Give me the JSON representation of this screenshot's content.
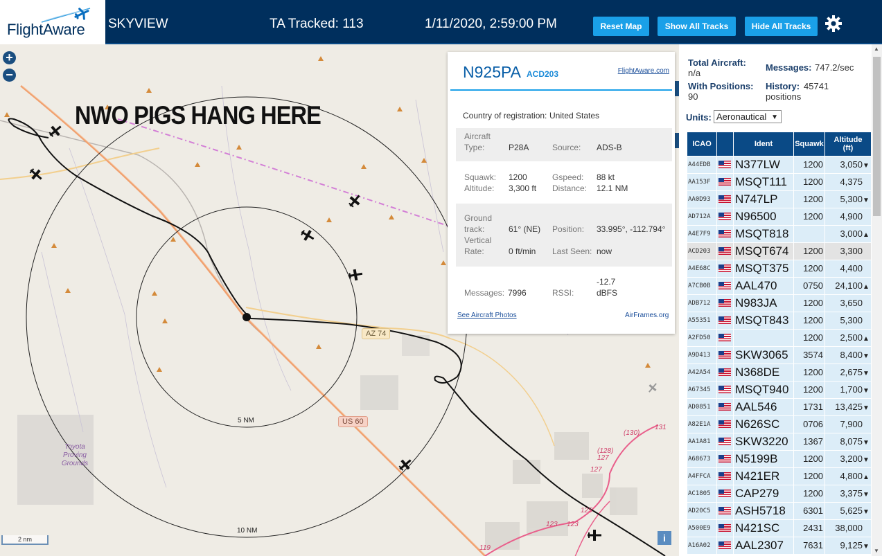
{
  "header": {
    "logo_text": "FlightAware",
    "app_name": "SKYVIEW",
    "ta_tracked": "TA Tracked: 113",
    "datetime": "1/11/2020, 2:59:00 PM",
    "reset_map": "Reset Map",
    "show_all_tracks": "Show All Tracks",
    "hide_all_tracks": "Hide All Tracks"
  },
  "map": {
    "zoom_in": "+",
    "zoom_out": "−",
    "annotation": "NWO PIGS HANG HERE",
    "ring_5": "5 NM",
    "ring_10": "10 NM",
    "road_az74": "AZ 74",
    "road_us60": "US 60",
    "place_label": "Toyota Proving Grounds",
    "scale": "2 nm",
    "info": "i",
    "road_nums": [
      "131",
      "(130)",
      "(128)",
      "127",
      "127",
      "125",
      "123",
      "123",
      "119"
    ]
  },
  "popup": {
    "registration": "N925PA",
    "ident": "ACD203",
    "fa_link": "FlightAware.com",
    "country_label": "Country of registration:",
    "country": "United States",
    "aircraft_type_label": "Aircraft Type:",
    "aircraft_type": "P28A",
    "source_label": "Source:",
    "source": "ADS-B",
    "squawk_label": "Squawk:",
    "squawk": "1200",
    "gspeed_label": "Gspeed:",
    "gspeed": "88 kt",
    "altitude_label": "Altitude:",
    "altitude": "3,300 ft",
    "distance_label": "Distance:",
    "distance": "12.1 NM",
    "ground_track_label": "Ground track:",
    "ground_track": "61° (NE)",
    "position_label": "Position:",
    "position": "33.995°, -112.794°",
    "vertical_rate_label": "Vertical Rate:",
    "vertical_rate": "0 ft/min",
    "last_seen_label": "Last Seen:",
    "last_seen": "now",
    "messages_label": "Messages:",
    "messages": "7996",
    "rssi_label": "RSSI:",
    "rssi": "-12.7 dBFS",
    "photos_link": "See Aircraft Photos",
    "airframes_link": "AirFrames.org"
  },
  "side": {
    "total_aircraft_label": "Total Aircraft:",
    "total_aircraft": "n/a",
    "messages_label": "Messages:",
    "messages": "747.2/sec",
    "with_positions_label": "With Positions:",
    "with_positions": "90",
    "history_label": "History:",
    "history": "45741 positions",
    "units_label": "Units:",
    "units_value": "Aeronautical",
    "columns": [
      "ICAO",
      "Ident",
      "Squawk",
      "Altitude (ft)"
    ],
    "rows": [
      {
        "icao": "A44EDB",
        "ident": "N377LW",
        "squawk": "1200",
        "alt": "3,050",
        "trend": "▼"
      },
      {
        "icao": "AA153F",
        "ident": "MSQT111",
        "squawk": "1200",
        "alt": "4,375",
        "trend": ""
      },
      {
        "icao": "AA0D93",
        "ident": "N747LP",
        "squawk": "1200",
        "alt": "5,300",
        "trend": "▼"
      },
      {
        "icao": "AD712A",
        "ident": "N96500",
        "squawk": "1200",
        "alt": "4,900",
        "trend": ""
      },
      {
        "icao": "A4E7F9",
        "ident": "MSQT818",
        "squawk": "",
        "alt": "3,000",
        "trend": "▲"
      },
      {
        "icao": "ACD203",
        "ident": "MSQT674",
        "squawk": "1200",
        "alt": "3,300",
        "trend": ""
      },
      {
        "icao": "A4E68C",
        "ident": "MSQT375",
        "squawk": "1200",
        "alt": "4,400",
        "trend": ""
      },
      {
        "icao": "A7CB0B",
        "ident": "AAL470",
        "squawk": "0750",
        "alt": "24,100",
        "trend": "▲"
      },
      {
        "icao": "ADB712",
        "ident": "N983JA",
        "squawk": "1200",
        "alt": "3,650",
        "trend": ""
      },
      {
        "icao": "A55351",
        "ident": "MSQT843",
        "squawk": "1200",
        "alt": "5,300",
        "trend": ""
      },
      {
        "icao": "A2FD50",
        "ident": "",
        "squawk": "1200",
        "alt": "2,500",
        "trend": "▲"
      },
      {
        "icao": "A9D413",
        "ident": "SKW3065",
        "squawk": "3574",
        "alt": "8,400",
        "trend": "▼"
      },
      {
        "icao": "A42A54",
        "ident": "N368DE",
        "squawk": "1200",
        "alt": "2,675",
        "trend": "▼"
      },
      {
        "icao": "A67345",
        "ident": "MSQT940",
        "squawk": "1200",
        "alt": "1,700",
        "trend": "▼"
      },
      {
        "icao": "AD0851",
        "ident": "AAL546",
        "squawk": "1731",
        "alt": "13,425",
        "trend": "▼"
      },
      {
        "icao": "A82E1A",
        "ident": "N626SC",
        "squawk": "0706",
        "alt": "7,900",
        "trend": ""
      },
      {
        "icao": "AA1A81",
        "ident": "SKW3220",
        "squawk": "1367",
        "alt": "8,075",
        "trend": "▼"
      },
      {
        "icao": "A68673",
        "ident": "N5199B",
        "squawk": "1200",
        "alt": "3,200",
        "trend": "▼"
      },
      {
        "icao": "A4FFCA",
        "ident": "N421ER",
        "squawk": "1200",
        "alt": "4,800",
        "trend": "▲"
      },
      {
        "icao": "AC1805",
        "ident": "CAP279",
        "squawk": "1200",
        "alt": "3,375",
        "trend": "▼"
      },
      {
        "icao": "AD20C5",
        "ident": "ASH5718",
        "squawk": "6301",
        "alt": "5,625",
        "trend": "▼"
      },
      {
        "icao": "A500E9",
        "ident": "N421SC",
        "squawk": "2431",
        "alt": "38,000",
        "trend": ""
      },
      {
        "icao": "A16A02",
        "ident": "AAL2307",
        "squawk": "7631",
        "alt": "9,125",
        "trend": "▼"
      }
    ]
  },
  "colors": {
    "header_bg": "#002f5d",
    "button": "#1aa0e8",
    "table_header": "#0a4a86",
    "row_bg": "#dcedf8"
  }
}
